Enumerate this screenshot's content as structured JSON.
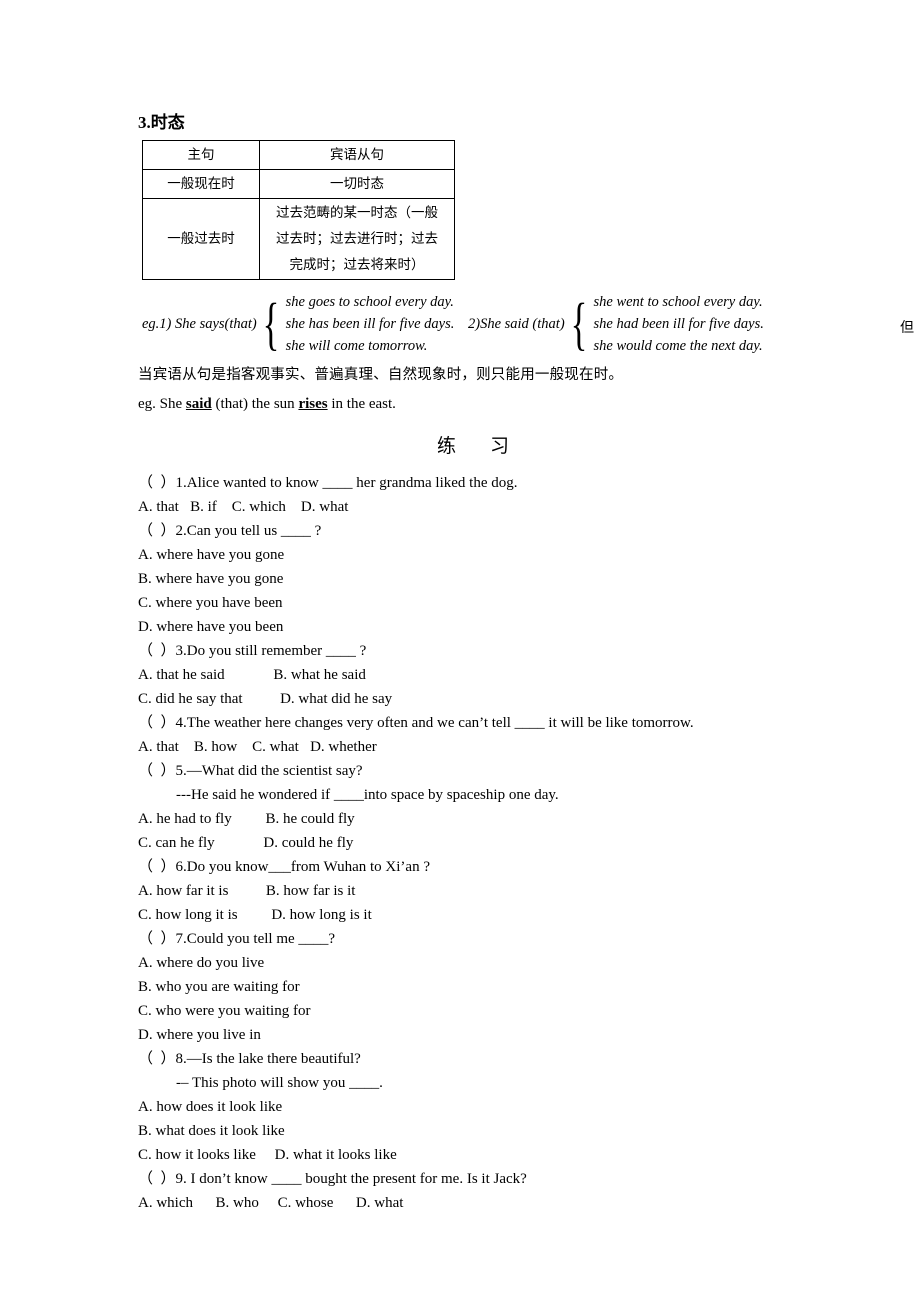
{
  "section": {
    "heading": "3.时态"
  },
  "tense_table": {
    "headers": [
      "主句",
      "宾语从句"
    ],
    "rows": [
      {
        "main": "一般现在时",
        "sub_lines": [
          "一切时态"
        ]
      },
      {
        "main": "一般过去时",
        "sub_lines": [
          "过去范畴的某一时态（一般",
          "过去时；过去进行时；过去",
          "完成时；过去将来时）"
        ]
      }
    ]
  },
  "examples": {
    "group1": {
      "lead": "eg.1) She says(that)",
      "items": [
        "she goes to school every day.",
        "she has been ill  for  five days.",
        "she will come tomorrow."
      ]
    },
    "group2": {
      "lead": "2)She said (that)",
      "items": [
        "she went to school every day.",
        "she had been ill  for  five days.",
        "she would come the next day."
      ]
    },
    "trailing_char": "但"
  },
  "notes": {
    "chinese": "当宾语从句是指客观事实、普遍真理、自然现象时，则只能用一般现在时。",
    "english_prefix": "eg. She ",
    "english_bold1": "said",
    "english_mid": " (that) the sun ",
    "english_bold2": "rises",
    "english_suffix": " in the east."
  },
  "exercise": {
    "title_left": "练",
    "title_right": "习",
    "questions": [
      {
        "stem": "（  ）1.Alice wanted to know ____ her grandma liked the dog.",
        "option_lines": [
          "A. that   B. if    C. which    D. what"
        ]
      },
      {
        "stem": "（  ）2.Can you tell us ____ ?",
        "option_lines": [
          "A. where have you gone",
          "B. where have you gone",
          "C. where you have been",
          "D. where have you been"
        ]
      },
      {
        "stem": "（  ）3.Do you still remember ____ ?",
        "option_lines": [
          "A. that he said             B. what he said",
          "C. did he say that          D. what did he say"
        ]
      },
      {
        "stem": "（  ）4.The weather here changes very often and we can’t tell ____ it will be like tomorrow.",
        "option_lines": [
          "A. that    B. how    C. what   D. whether"
        ]
      },
      {
        "stem": "（  ）5.—What did the scientist say?",
        "sub_stem": "---He said he wondered if ____into space by spaceship one day.",
        "option_lines": [
          "A. he had to fly         B. he could fly",
          "C. can he fly             D. could he fly"
        ]
      },
      {
        "stem": "（  ）6.Do you know___from Wuhan to Xi’an ?",
        "option_lines": [
          "A. how far it is          B. how far is it",
          "C. how long it is         D. how long is it"
        ]
      },
      {
        "stem": "（  ）7.Could you tell me ____?",
        "option_lines": [
          "A. where do you live",
          "B. who you are waiting for",
          "C. who were you waiting for",
          "D. where you live in"
        ]
      },
      {
        "stem": "（  ）8.—Is the lake there beautiful?",
        "sub_stem": "-– This photo will show you ____.",
        "option_lines": [
          "A. how does it look like",
          "B. what does it look like",
          "C. how it looks like     D. what it looks like"
        ]
      },
      {
        "stem": "（  ）9. I don’t know ____ bought the present for me. Is it Jack?",
        "option_lines": [
          "A. which      B. who     C. whose      D. what"
        ]
      }
    ]
  }
}
